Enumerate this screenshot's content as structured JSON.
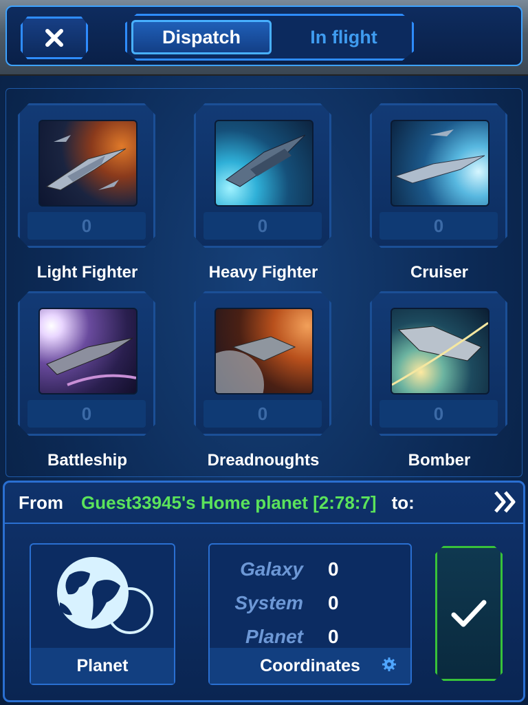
{
  "tabs": {
    "dispatch_label": "Dispatch",
    "in_flight_label": "In flight",
    "active": "Dispatch"
  },
  "ships": [
    {
      "name": "Light Fighter",
      "count": "0"
    },
    {
      "name": "Heavy Fighter",
      "count": "0"
    },
    {
      "name": "Cruiser",
      "count": "0"
    },
    {
      "name": "Battleship",
      "count": "0"
    },
    {
      "name": "Dreadnoughts",
      "count": "0"
    },
    {
      "name": "Bomber",
      "count": "0"
    }
  ],
  "route": {
    "from_label": "From",
    "from_planet": "Guest33945's Home planet [2:78:7]",
    "to_label": "to:"
  },
  "target": {
    "planet_label": "Planet",
    "coordinates_label": "Coordinates",
    "galaxy_label": "Galaxy",
    "galaxy_value": "0",
    "system_label": "System",
    "system_value": "0",
    "planet_coord_label": "Planet",
    "planet_coord_value": "0"
  },
  "colors": {
    "accent": "#2e8cff",
    "planet_text": "#5be35b",
    "confirm": "#38c23a"
  },
  "icons": {
    "close": "close-icon",
    "forward": "double-chevron-right-icon",
    "globe": "globe-icon",
    "gear": "gear-icon",
    "confirm": "checkmark-icon"
  }
}
